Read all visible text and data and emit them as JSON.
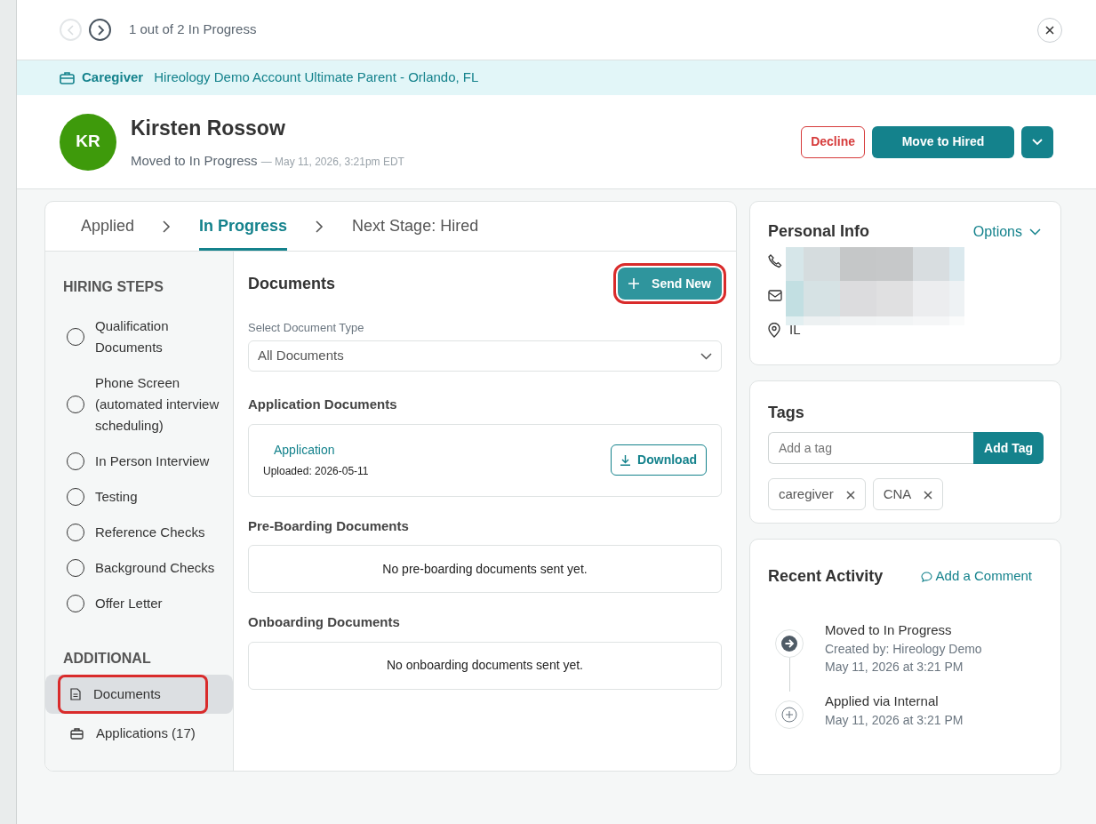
{
  "pager": {
    "text": "1 out of 2 In Progress",
    "prev_disabled": true,
    "next_disabled": false
  },
  "job": {
    "title": "Caregiver",
    "location": "Hireology Demo Account Ultimate Parent - Orlando, FL"
  },
  "candidate": {
    "initials": "KR",
    "name": "Kirsten Rossow",
    "status": "Moved to In Progress",
    "timestamp": "— May 11, 2026, 3:21pm EDT"
  },
  "actions": {
    "decline": "Decline",
    "primary": "Move to Hired"
  },
  "stages": [
    {
      "label": "Applied",
      "selected": false
    },
    {
      "label": "In Progress",
      "selected": true
    },
    {
      "label": "Next Stage: Hired",
      "selected": false
    }
  ],
  "hiring_steps": {
    "heading": "HIRING STEPS",
    "items": [
      {
        "label": "Qualification Documents",
        "checked": false
      },
      {
        "label": "Phone Screen (automated interview scheduling)",
        "checked": false
      },
      {
        "label": "In Person Interview",
        "checked": false
      },
      {
        "label": "Testing",
        "checked": false
      },
      {
        "label": "Reference Checks",
        "checked": false
      },
      {
        "label": "Background Checks",
        "checked": false
      },
      {
        "label": "Offer Letter",
        "checked": false
      }
    ]
  },
  "additional": {
    "heading": "ADDITIONAL",
    "items": [
      {
        "label": "Documents",
        "kind": "document",
        "selected": true,
        "highlighted": true
      },
      {
        "label": "Applications (17)",
        "kind": "briefcase",
        "selected": false,
        "highlighted": false
      }
    ]
  },
  "documents": {
    "title": "Documents",
    "send_button": {
      "label": "Send New",
      "highlighted": true
    },
    "type_label": "Select Document Type",
    "type_value": "All Documents",
    "sections": [
      {
        "heading": "Application Documents",
        "files": [
          {
            "name": "Application",
            "uploaded": "Uploaded: 2026-05-11",
            "button": "Download"
          }
        ]
      },
      {
        "heading": "Pre-Boarding Documents",
        "empty": "No pre-boarding documents sent yet."
      },
      {
        "heading": "Onboarding Documents",
        "empty": "No onboarding documents sent yet."
      }
    ]
  },
  "personal_info": {
    "title": "Personal Info",
    "options": "Options",
    "location": "IL"
  },
  "tags": {
    "title": "Tags",
    "placeholder": "Add a tag",
    "button": "Add Tag",
    "items": [
      "caregiver",
      "CNA"
    ]
  },
  "activity": {
    "title": "Recent Activity",
    "comment_link": "Add a Comment",
    "events": [
      {
        "kind": "moved",
        "title": "Moved to In Progress",
        "details": [
          "Created by: Hireology Demo",
          "May 11, 2026 at 3:21 PM"
        ]
      },
      {
        "kind": "applied",
        "title": "Applied via Internal",
        "details": [
          "May 11, 2026 at 3:21 PM"
        ]
      }
    ]
  }
}
